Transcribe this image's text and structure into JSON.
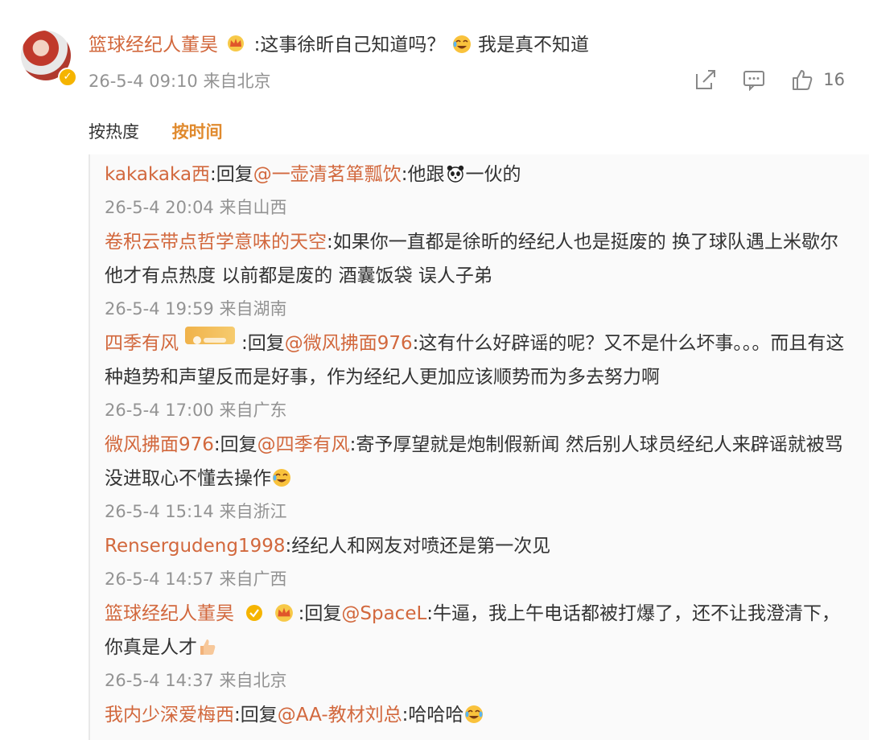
{
  "root": {
    "username": "篮球经纪人董昊",
    "text": ":这事徐昕自己知道吗？",
    "text_tail": "我是真不知道",
    "time": "26-5-4 09:10",
    "location": "来自北京",
    "like_count": "16",
    "icons": [
      "share-icon",
      "comment-icon",
      "like-icon"
    ]
  },
  "sort": {
    "hot": "按热度",
    "time": "按时间"
  },
  "replies": [
    {
      "name": "kakakaka西",
      "sep": ":回复",
      "at": "@一壶清茗箪瓢饮",
      "body": ":他跟",
      "tail": "一伙的",
      "time": "26-5-4 20:04",
      "loc": "来自山西"
    },
    {
      "name": "卷积云带点哲学意味的天空",
      "body": ":如果你一直都是徐昕的经纪人也是挺废的 换了球队遇上米歇尔 他才有点热度 以前都是废的 酒囊饭袋 误人子弟",
      "time": "26-5-4 19:59",
      "loc": "来自湖南"
    },
    {
      "name": "四季有风",
      "sep": ":回复",
      "at": "@微风拂面976",
      "body": ":这有什么好辟谣的呢？又不是什么坏事。。。而且有这种趋势和声望反而是好事，作为经纪人更加应该顺势而为多去努力啊",
      "time": "26-5-4 17:00",
      "loc": "来自广东"
    },
    {
      "name": "微风拂面976",
      "sep": ":回复",
      "at": "@四季有风",
      "body": ":寄予厚望就是炮制假新闻 然后别人球员经纪人来辟谣就被骂没进取心不懂去操作",
      "time": "26-5-4 15:14",
      "loc": "来自浙江"
    },
    {
      "name": "Rensergudeng1998",
      "body": ":经纪人和网友对喷还是第一次见",
      "time": "26-5-4 14:57",
      "loc": "来自广西"
    },
    {
      "name": "篮球经纪人董昊",
      "sep": ":回复",
      "at": "@SpaceL",
      "body": ":牛逼，我上午电话都被打爆了，还不让我澄清下，你真是人才",
      "time": "26-5-4 14:37",
      "loc": "来自北京"
    },
    {
      "name": "我内少深爱梅西",
      "sep": ":回复",
      "at": "@AA-教材刘总",
      "body": ":哈哈哈"
    }
  ],
  "colors": {
    "username": "#d2683d",
    "sort_active": "#e08a2e",
    "meta": "#939393"
  }
}
